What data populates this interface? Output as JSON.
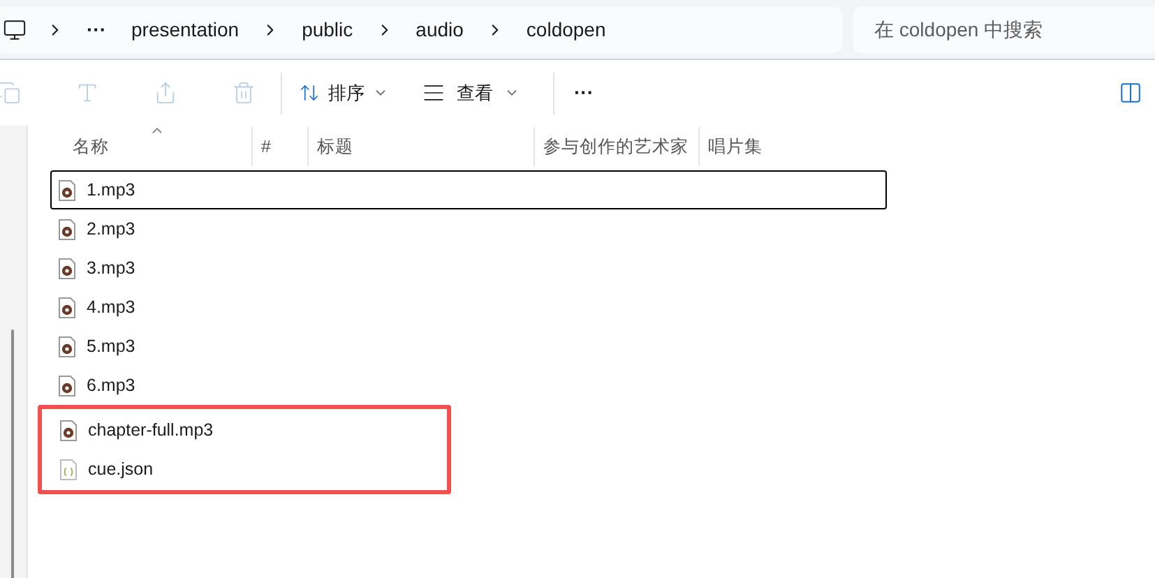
{
  "address_bar": {
    "more": "···",
    "crumbs": [
      "presentation",
      "public",
      "audio",
      "coldopen"
    ]
  },
  "search": {
    "placeholder": "在 coldopen 中搜索"
  },
  "toolbar": {
    "actions": [
      {
        "kind": "copy",
        "disabled": true
      },
      {
        "kind": "rename",
        "disabled": true
      },
      {
        "kind": "share",
        "disabled": true
      },
      {
        "kind": "delete",
        "disabled": true
      }
    ],
    "sort": {
      "label": "排序"
    },
    "view": {
      "label": "查看"
    },
    "more": "···"
  },
  "columns": [
    "名称",
    "#",
    "标题",
    "参与创作的艺术家",
    "唱片集"
  ],
  "files": [
    {
      "name": "1.mp3",
      "kind": "audio",
      "selected": true,
      "highlighted": false
    },
    {
      "name": "2.mp3",
      "kind": "audio",
      "selected": false,
      "highlighted": false
    },
    {
      "name": "3.mp3",
      "kind": "audio",
      "selected": false,
      "highlighted": false
    },
    {
      "name": "4.mp3",
      "kind": "audio",
      "selected": false,
      "highlighted": false
    },
    {
      "name": "5.mp3",
      "kind": "audio",
      "selected": false,
      "highlighted": false
    },
    {
      "name": "6.mp3",
      "kind": "audio",
      "selected": false,
      "highlighted": false
    },
    {
      "name": "chapter-full.mp3",
      "kind": "audio",
      "selected": false,
      "highlighted": true
    },
    {
      "name": "cue.json",
      "kind": "json",
      "selected": false,
      "highlighted": true
    }
  ]
}
